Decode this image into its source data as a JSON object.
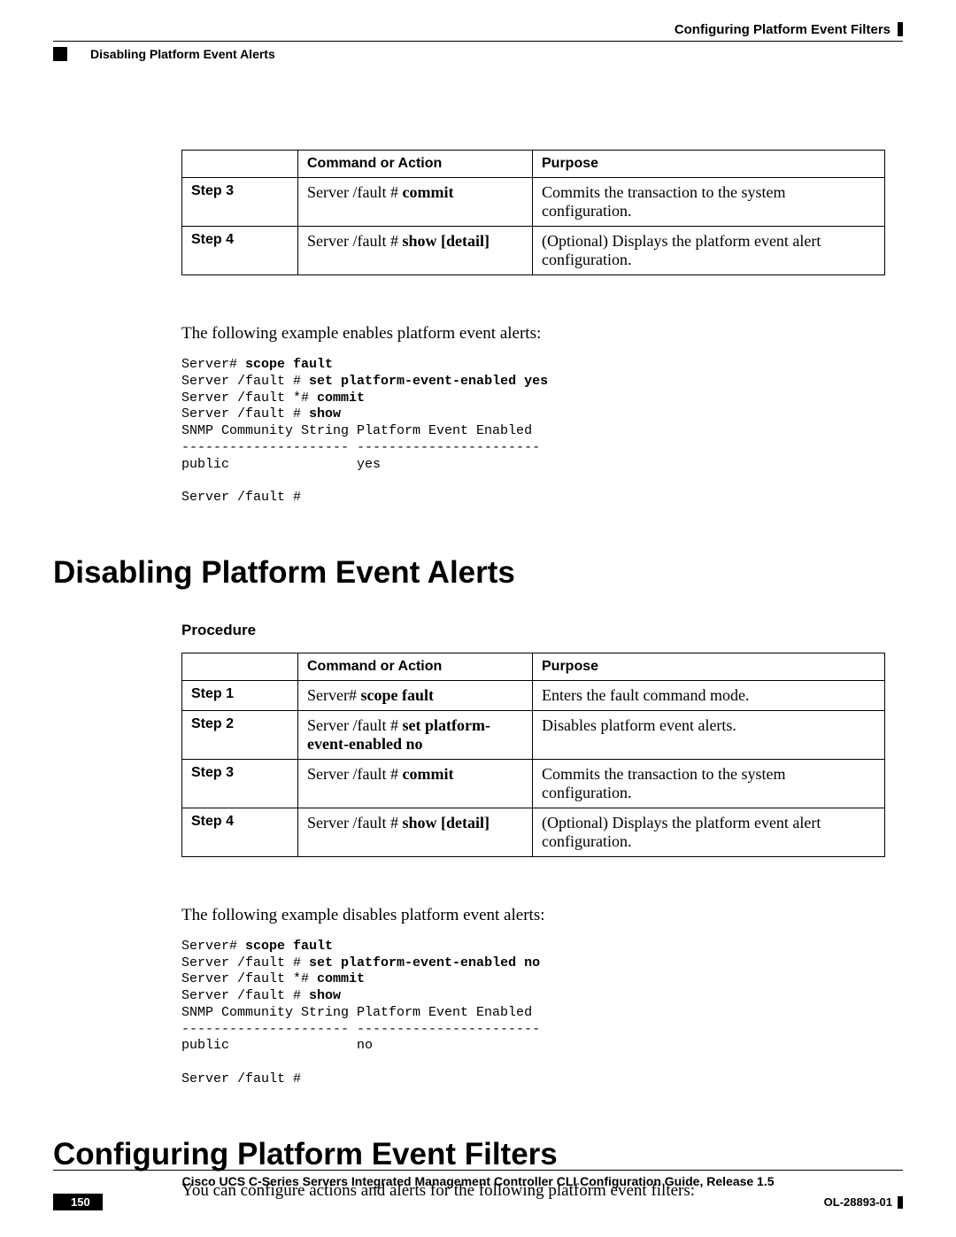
{
  "header": {
    "chapter": "Configuring Platform Event Filters",
    "section": "Disabling Platform Event Alerts"
  },
  "table1": {
    "h_blank": "",
    "h_cmd": "Command or Action",
    "h_purpose": "Purpose",
    "rows": [
      {
        "step": "Step 3",
        "cmd_prefix": "Server /fault # ",
        "cmd_bold": "commit",
        "purpose": "Commits the transaction to the system configuration."
      },
      {
        "step": "Step 4",
        "cmd_prefix": "Server /fault # ",
        "cmd_bold": "show [detail]",
        "purpose": "(Optional) Displays the platform event alert configuration."
      }
    ]
  },
  "example1_intro": "The following example enables platform event alerts:",
  "example1": {
    "l1a": "Server# ",
    "l1b": "scope fault",
    "l2a": "Server /fault # ",
    "l2b": "set platform-event-enabled yes",
    "l3a": "Server /fault *# ",
    "l3b": "commit",
    "l4a": "Server /fault # ",
    "l4b": "show",
    "l5": "SNMP Community String Platform Event Enabled",
    "l6": "--------------------- -----------------------",
    "l7": "public                yes",
    "l8": "",
    "l9": "Server /fault #"
  },
  "h1_disable": "Disabling Platform Event Alerts",
  "procedure_label": "Procedure",
  "table2": {
    "h_blank": "",
    "h_cmd": "Command or Action",
    "h_purpose": "Purpose",
    "rows": [
      {
        "step": "Step 1",
        "cmd_prefix": "Server# ",
        "cmd_bold": "scope fault",
        "purpose": "Enters the fault command mode."
      },
      {
        "step": "Step 2",
        "cmd_prefix": "Server /fault # ",
        "cmd_bold": "set platform-event-enabled no",
        "purpose": "Disables platform event alerts."
      },
      {
        "step": "Step 3",
        "cmd_prefix": "Server /fault # ",
        "cmd_bold": "commit",
        "purpose": "Commits the transaction to the system configuration."
      },
      {
        "step": "Step 4",
        "cmd_prefix": "Server /fault # ",
        "cmd_bold": "show [detail]",
        "purpose": "(Optional) Displays the platform event alert configuration."
      }
    ]
  },
  "example2_intro": "The following example disables platform event alerts:",
  "example2": {
    "l1a": "Server# ",
    "l1b": "scope fault",
    "l2a": "Server /fault # ",
    "l2b": "set platform-event-enabled no",
    "l3a": "Server /fault *# ",
    "l3b": "commit",
    "l4a": "Server /fault # ",
    "l4b": "show",
    "l5": "SNMP Community String Platform Event Enabled",
    "l6": "--------------------- -----------------------",
    "l7": "public                no",
    "l8": "",
    "l9": "Server /fault #"
  },
  "h1_config": "Configuring Platform Event Filters",
  "config_body": "You can configure actions and alerts for the following platform event filters:",
  "footer": {
    "title": "Cisco UCS C-Series Servers Integrated Management Controller CLI Configuration Guide, Release 1.5",
    "page": "150",
    "docid": "OL-28893-01"
  }
}
